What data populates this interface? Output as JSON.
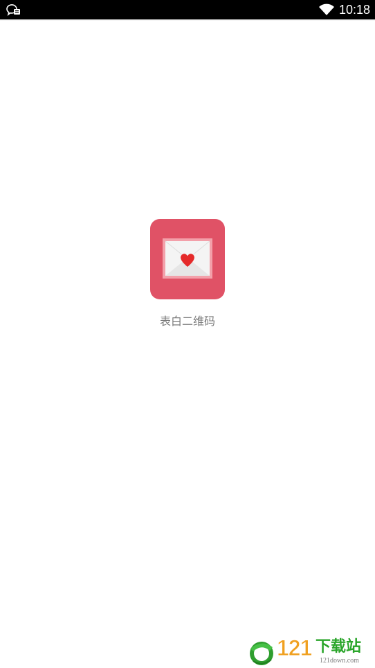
{
  "status_bar": {
    "time": "10:18",
    "left_icon": "chat-notification-icon",
    "signal_icon": "wifi-icon"
  },
  "app": {
    "icon": "love-letter-envelope-icon",
    "label": "表白二维码",
    "icon_color": "#e05266",
    "heart_color": "#e52a2a"
  },
  "watermark": {
    "brand_number": "121",
    "brand_suffix": "下载站",
    "url": "121down.com"
  }
}
